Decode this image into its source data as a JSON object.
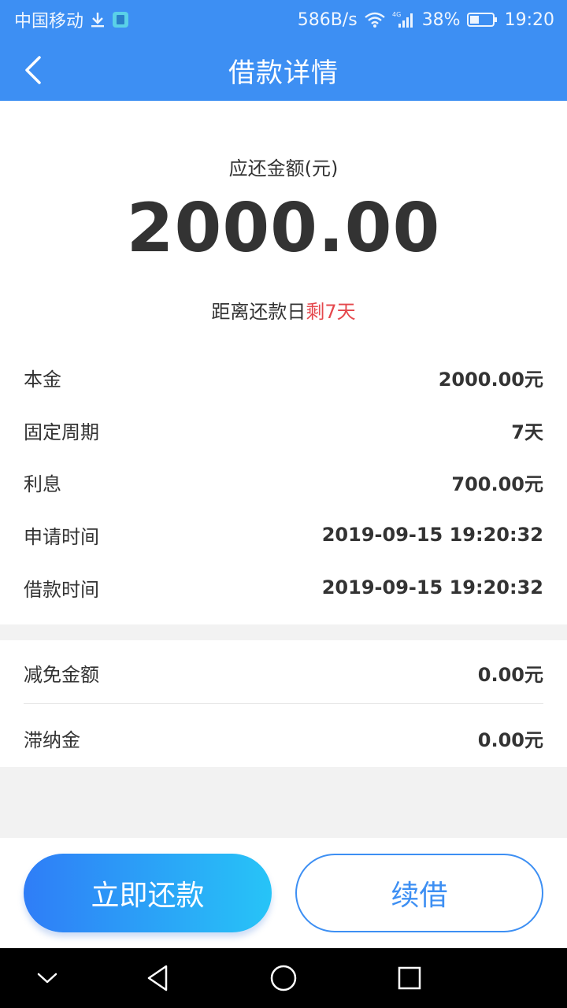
{
  "status_bar": {
    "carrier": "中国移动",
    "speed": "586B/s",
    "network_type": "4G",
    "battery": "38%",
    "time": "19:20"
  },
  "header": {
    "title": "借款详情"
  },
  "summary": {
    "label": "应还金额(元)",
    "amount": "2000.00",
    "due_prefix": "距离还款日",
    "due_remaining": "剩7天"
  },
  "details": [
    {
      "label": "本金",
      "value": "2000.00元"
    },
    {
      "label": "固定周期",
      "value": "7天"
    },
    {
      "label": "利息",
      "value": "700.00元"
    },
    {
      "label": "申请时间",
      "value": "2019-09-15 19:20:32"
    },
    {
      "label": "借款时间",
      "value": "2019-09-15 19:20:32"
    }
  ],
  "extra": [
    {
      "label": "减免金额",
      "value": "0.00元"
    },
    {
      "label": "滞纳金",
      "value": "0.00元"
    }
  ],
  "actions": {
    "repay_label": "立即还款",
    "renew_label": "续借"
  },
  "colors": {
    "primary": "#3d8ff3",
    "gradient_start": "#2f7df7",
    "gradient_end": "#27c4f7",
    "warning": "#e5484d",
    "text": "#333333"
  }
}
